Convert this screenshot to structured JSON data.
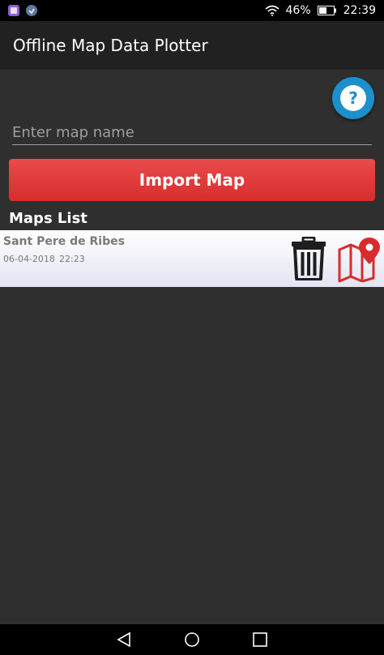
{
  "status_bar": {
    "battery": "46%",
    "time": "22:39",
    "icons": [
      "app-notification-icon",
      "download-notification-icon",
      "wifi-icon",
      "battery-icon"
    ]
  },
  "app": {
    "title": "Offline Map Data Plotter"
  },
  "help": {
    "label": "?"
  },
  "map_name": {
    "placeholder": "Enter map name",
    "value": ""
  },
  "import": {
    "label": "Import Map"
  },
  "maps_list": {
    "heading": "Maps List",
    "items": [
      {
        "name": "Sant Pere de Ribes",
        "date": "06-04-2018",
        "time": "22:23"
      }
    ]
  },
  "colors": {
    "accent_red": "#e03a3a",
    "help_blue": "#1c8fcc",
    "background": "#2f2f2f",
    "appbar": "#212121"
  },
  "nav": {
    "icons": [
      "back-icon",
      "home-icon",
      "recents-icon"
    ]
  }
}
